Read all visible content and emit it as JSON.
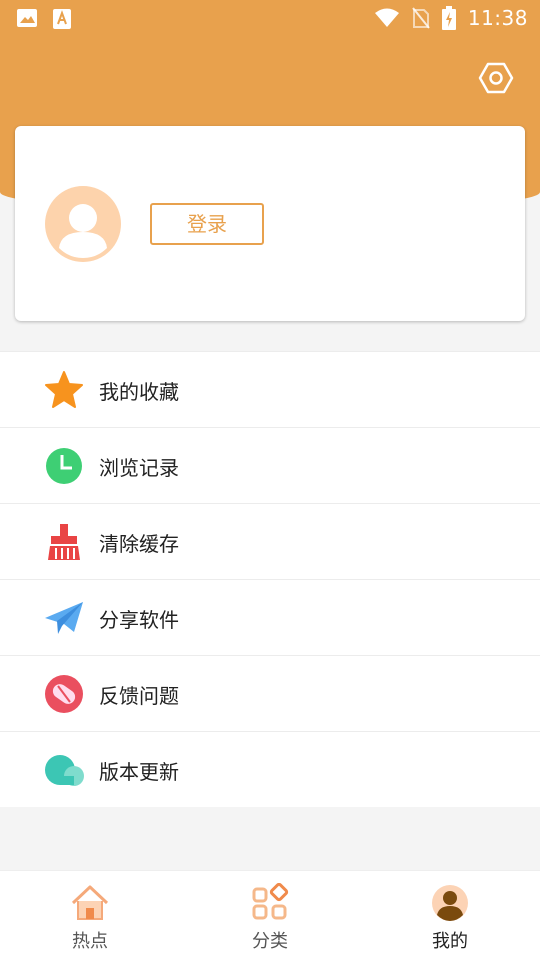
{
  "status_bar": {
    "time": "11:38"
  },
  "header": {
    "settings_icon": "hexagon-settings-icon",
    "accent_color": "#e8a14d"
  },
  "profile": {
    "login_label": "登录"
  },
  "menu": {
    "items": [
      {
        "label": "我的收藏",
        "icon": "star-icon"
      },
      {
        "label": "浏览记录",
        "icon": "clock-icon"
      },
      {
        "label": "清除缓存",
        "icon": "broom-icon"
      },
      {
        "label": "分享软件",
        "icon": "paper-plane-icon"
      },
      {
        "label": "反馈问题",
        "icon": "feedback-icon"
      },
      {
        "label": "版本更新",
        "icon": "cloud-icon"
      }
    ]
  },
  "bottom_nav": {
    "tabs": [
      {
        "label": "热点",
        "icon": "home-icon"
      },
      {
        "label": "分类",
        "icon": "category-icon"
      },
      {
        "label": "我的",
        "icon": "user-icon",
        "active": true
      }
    ]
  }
}
